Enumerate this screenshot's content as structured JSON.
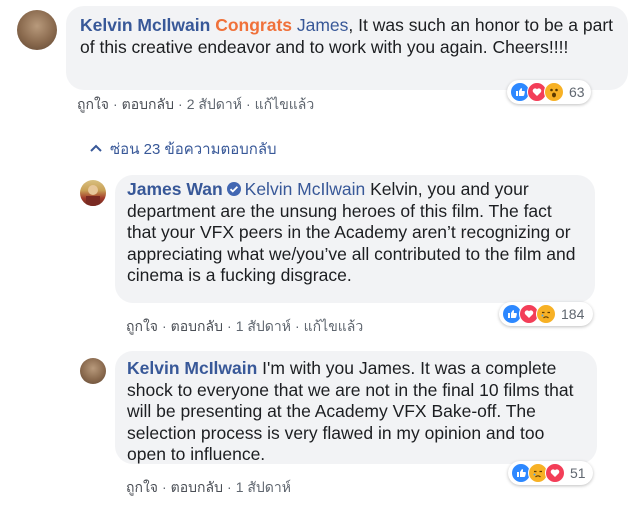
{
  "comment1": {
    "author": "Kelvin McIlwain",
    "mention": "Congrats",
    "mention2": "James",
    "text": ", It was such an honor to be a part of this creative endeavor and to work with you again. Cheers!!!!",
    "actions": {
      "like": "ถูกใจ",
      "reply": "ตอบกลับ",
      "time": "2 สัปดาห์",
      "edited": "แก้ไขแล้ว"
    },
    "reactions": {
      "icons": [
        "like-icon",
        "love-icon",
        "wow-icon"
      ],
      "count": "63"
    }
  },
  "hide_replies": "ซ่อน 23 ข้อความตอบกลับ",
  "reply1": {
    "author": "James Wan",
    "mention": "Kelvin McIlwain",
    "text": " Kelvin, you and your department are the unsung heroes of this film. The fact that your VFX peers in the Academy aren’t recognizing or appreciating what we/you’ve all contributed to the film and cinema is a fucking disgrace.",
    "actions": {
      "like": "ถูกใจ",
      "reply": "ตอบกลับ",
      "time": "1 สัปดาห์",
      "edited": "แก้ไขแล้ว"
    },
    "reactions": {
      "icons": [
        "like-icon",
        "love-icon",
        "sad-icon"
      ],
      "count": "184"
    }
  },
  "reply2": {
    "author": "Kelvin McIlwain",
    "text": " I'm with you James. It was a complete shock to everyone that we are not in the final 10 films that will be presenting at the Academy VFX Bake-off. The selection process is very flawed in my opinion and too open to influence.",
    "actions": {
      "like": "ถูกใจ",
      "reply": "ตอบกลับ",
      "time": "1 สัปดาห์"
    },
    "reactions": {
      "icons": [
        "like-icon",
        "sad-icon",
        "love-icon"
      ],
      "count": "51"
    }
  }
}
